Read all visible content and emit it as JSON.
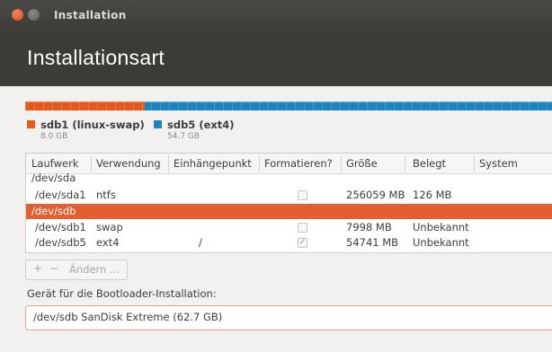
{
  "window": {
    "title": "Installation",
    "heading": "Installationsart"
  },
  "colors": {
    "swap": "#e35a1b",
    "ext4": "#1c84c0",
    "selected_row": "#e15f30"
  },
  "legend": [
    {
      "name": "sdb1 (linux-swap)",
      "size": "8.0 GB",
      "color": "#e35a1b"
    },
    {
      "name": "sdb5 (ext4)",
      "size": "54.7 GB",
      "color": "#1c84c0"
    }
  ],
  "partition_bar": {
    "swap_fraction": 0.127,
    "ext4_fraction": 0.873
  },
  "table": {
    "headers": [
      "Laufwerk",
      "Verwendung",
      "Einhängepunkt",
      "Formatieren?",
      "Größe",
      "Belegt",
      "System"
    ],
    "rows": [
      {
        "device": "/dev/sda",
        "use": "",
        "mount": "",
        "format": "",
        "size": "",
        "used": "",
        "system": ""
      },
      {
        "device": "/dev/sda1",
        "use": "ntfs",
        "mount": "",
        "format": "unchecked",
        "size": "256059 MB",
        "used": "126 MB",
        "system": ""
      },
      {
        "device": "/dev/sdb",
        "use": "",
        "mount": "",
        "format": "",
        "size": "",
        "used": "",
        "system": ""
      },
      {
        "device": "/dev/sdb1",
        "use": "swap",
        "mount": "",
        "format": "unchecked",
        "size": "7998 MB",
        "used": "Unbekannt",
        "system": ""
      },
      {
        "device": "/dev/sdb5",
        "use": "ext4",
        "mount": "/",
        "format": "checked",
        "size": "54741 MB",
        "used": "Unbekannt",
        "system": ""
      }
    ]
  },
  "toolbar": {
    "add": "+",
    "remove": "−",
    "change": "Ändern ..."
  },
  "bootloader": {
    "label": "Gerät für die Bootloader-Installation:",
    "value": "/dev/sdb   SanDisk Extreme (62.7 GB)"
  }
}
